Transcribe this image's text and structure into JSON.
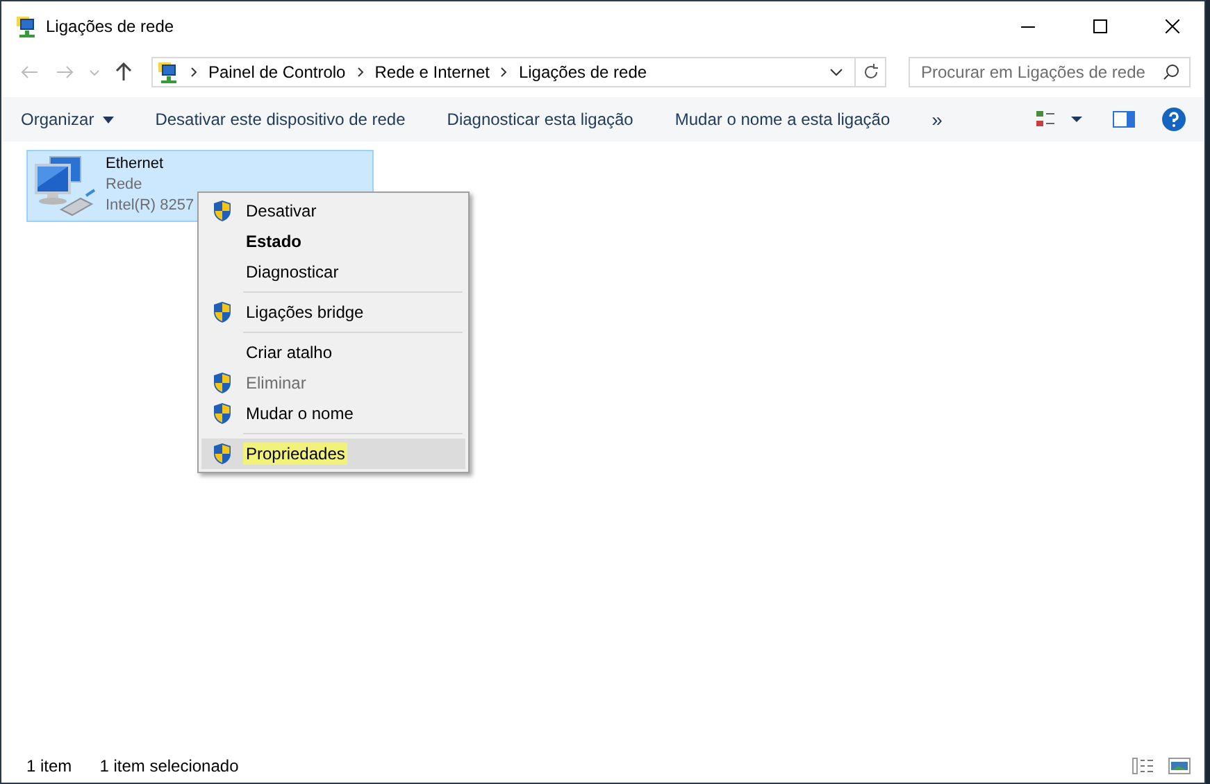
{
  "window": {
    "title": "Ligações de rede"
  },
  "address": {
    "crumbs": [
      "Painel de Controlo",
      "Rede e Internet",
      "Ligações de rede"
    ]
  },
  "search": {
    "placeholder": "Procurar em Ligações de rede"
  },
  "toolbar": {
    "items": [
      {
        "label": "Organizar",
        "kind": "dropdown"
      },
      {
        "label": "Desativar este dispositivo de rede",
        "kind": "command"
      },
      {
        "label": "Diagnosticar esta ligação",
        "kind": "command"
      },
      {
        "label": "Mudar o nome a esta ligação",
        "kind": "command"
      },
      {
        "label": "»",
        "kind": "more"
      }
    ]
  },
  "connections": [
    {
      "name": "Ethernet",
      "network": "Rede",
      "adapter": "Intel(R) 8257",
      "selected": true
    }
  ],
  "context_menu": {
    "items": [
      {
        "kind": "item",
        "label": "Desativar",
        "shield": true,
        "bold": false,
        "disabled": false,
        "selected": false,
        "highlighted": false
      },
      {
        "kind": "item",
        "label": "Estado",
        "shield": false,
        "bold": true,
        "disabled": false,
        "selected": false,
        "highlighted": false
      },
      {
        "kind": "item",
        "label": "Diagnosticar",
        "shield": false,
        "bold": false,
        "disabled": false,
        "selected": false,
        "highlighted": false
      },
      {
        "kind": "separator"
      },
      {
        "kind": "item",
        "label": "Ligações bridge",
        "shield": true,
        "bold": false,
        "disabled": false,
        "selected": false,
        "highlighted": false
      },
      {
        "kind": "separator"
      },
      {
        "kind": "item",
        "label": "Criar atalho",
        "shield": false,
        "bold": false,
        "disabled": false,
        "selected": false,
        "highlighted": false
      },
      {
        "kind": "item",
        "label": "Eliminar",
        "shield": true,
        "bold": false,
        "disabled": true,
        "selected": false,
        "highlighted": false
      },
      {
        "kind": "item",
        "label": "Mudar o nome",
        "shield": true,
        "bold": false,
        "disabled": false,
        "selected": false,
        "highlighted": false
      },
      {
        "kind": "separator"
      },
      {
        "kind": "item",
        "label": "Propriedades",
        "shield": true,
        "bold": false,
        "disabled": false,
        "selected": true,
        "highlighted": true
      }
    ]
  },
  "status_bar": {
    "count": "1 item",
    "selection": "1 item selecionado"
  }
}
